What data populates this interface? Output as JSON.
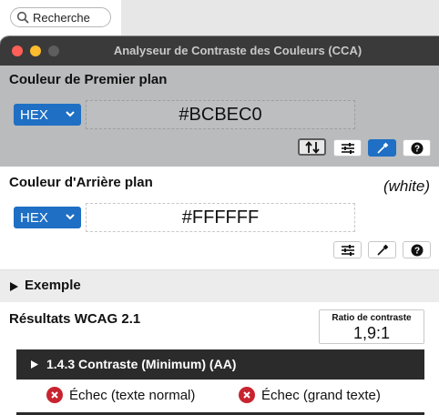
{
  "search": {
    "label": "Recherche"
  },
  "window": {
    "title": "Analyseur de Contraste des Couleurs (CCA)"
  },
  "foreground": {
    "label": "Couleur de Premier plan",
    "format": "HEX",
    "value": "#BCBEC0"
  },
  "background": {
    "label": "Couleur d'Arrière plan",
    "format": "HEX",
    "value": "#FFFFFF",
    "color_name": "(white)"
  },
  "example": {
    "label": "Exemple"
  },
  "results": {
    "header": "Résultats WCAG 2.1",
    "ratio_label": "Ratio de contraste",
    "ratio_value": "1,9:1",
    "criterion": "1.4.3 Contraste (Minimum) (AA)",
    "normal_text": "Échec (texte normal)",
    "large_text": "Échec (grand texte)"
  },
  "colors": {
    "accent": "#1f6fc4",
    "foreground_swatch": "#BCBEC0",
    "fail": "#c8242f",
    "titlebar": "#3a3a3a"
  },
  "icons": [
    "search-icon",
    "swap-icon",
    "sliders-icon",
    "eyedropper-icon",
    "help-icon",
    "chevron-down-icon",
    "fail-icon",
    "disclosure-triangle-icon"
  ]
}
